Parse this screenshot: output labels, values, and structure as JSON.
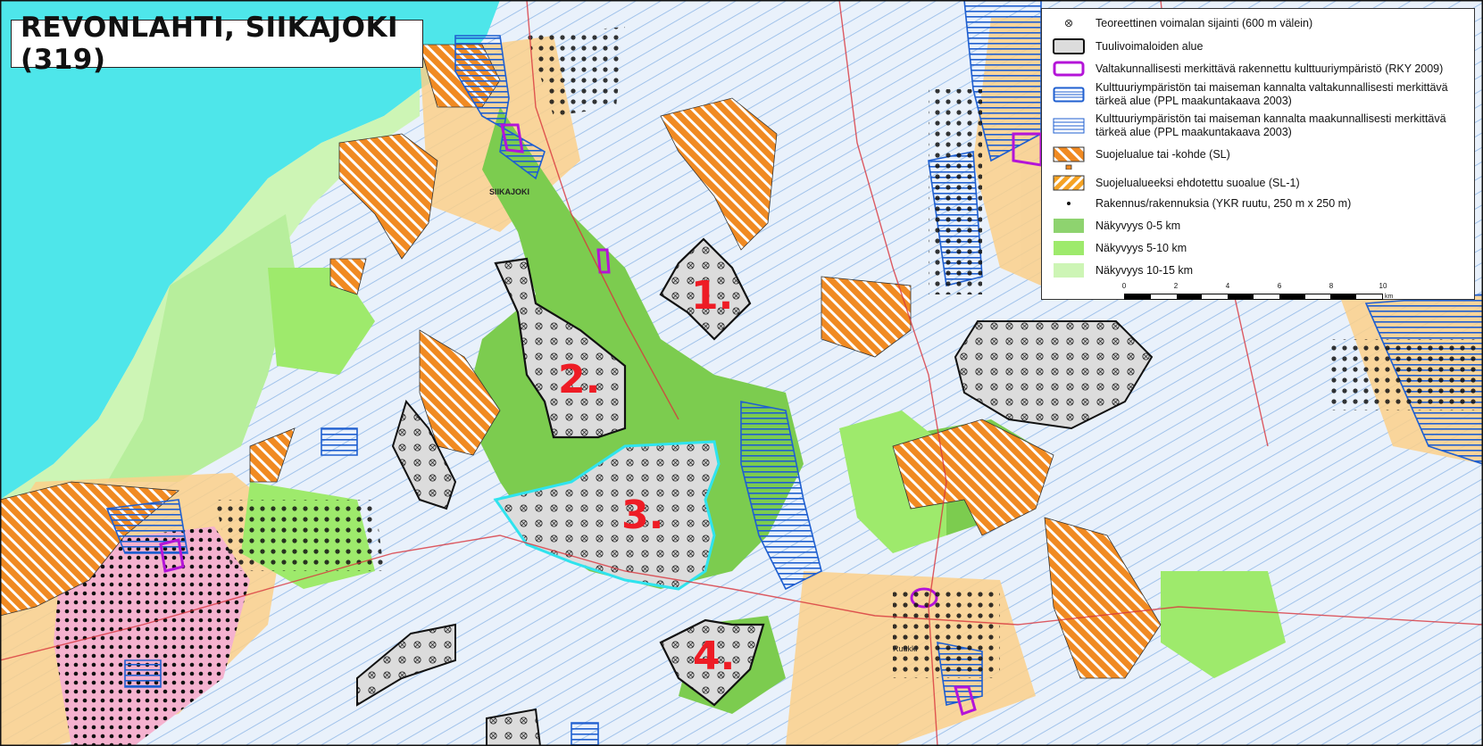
{
  "title": "REVONLAHTI, SIIKAJOKI (319)",
  "area_labels": [
    "1.",
    "2.",
    "3.",
    "4."
  ],
  "place_names": {
    "siikajoki": "SIIKAJOKI",
    "ruukki": "Ruukki"
  },
  "legend": {
    "items": [
      {
        "symbol": "turbine",
        "label": "Teoreettinen  voimalan sijainti (600 m välein)"
      },
      {
        "symbol": "wind-area",
        "label": "Tuulivoimaloiden alue"
      },
      {
        "symbol": "rky",
        "label": "Valtakunnallisesti merkittävä rakennettu kulttuuriympäristö (RKY 2009)"
      },
      {
        "symbol": "national-culture",
        "label": "Kulttuuriympäristön tai maiseman kannalta valtakunnallisesti merkittävä tärkeä alue (PPL maakuntakaava 2003)"
      },
      {
        "symbol": "regional-culture",
        "label": "Kulttuuriympäristön tai maiseman kannalta maakunnallisesti merkittävä tärkeä alue (PPL maakuntakaava 2003)"
      },
      {
        "symbol": "protection",
        "label": "Suojelualue tai -kohde (SL)"
      },
      {
        "symbol": "proposed-protection",
        "label": "Suojelualueeksi ehdotettu suoalue (SL-1)"
      },
      {
        "symbol": "building",
        "label": "Rakennus/rakennuksia (YKR ruutu, 250 m x 250 m)"
      },
      {
        "symbol": "vis-0-5",
        "label": "Näkyvyys 0-5 km"
      },
      {
        "symbol": "vis-5-10",
        "label": "Näkyvyys 5-10 km"
      },
      {
        "symbol": "vis-10-15",
        "label": "Näkyvyys 10-15 km"
      }
    ],
    "scale": {
      "ticks": [
        "0",
        "2",
        "4",
        "6",
        "8",
        "10"
      ],
      "unit": "km"
    }
  },
  "colors": {
    "sea": "#4ee6ea",
    "land": "#eef4fb",
    "vis_0_5": "#8ed36f",
    "vis_5_10": "#9eea6c",
    "vis_10_15": "#cdf5b5",
    "protection_orange": "#f08a22",
    "rky_purple": "#b414d8",
    "culture_blue": "#1f5fd0",
    "wind_area_fill": "#dcdcdc",
    "area3_outline": "#2fe3ee",
    "label_red": "#ee1c25"
  }
}
